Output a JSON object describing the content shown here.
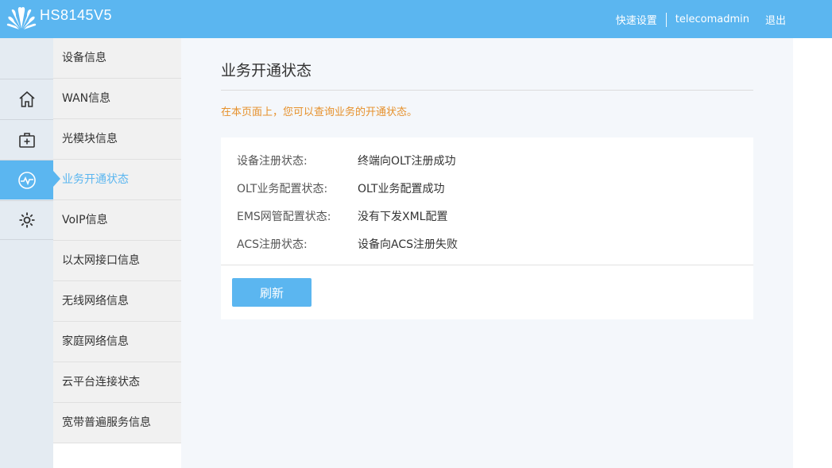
{
  "header": {
    "model": "HS8145V5",
    "quick_setup": "快速设置",
    "username": "telecomadmin",
    "logout": "退出",
    "accent_color": "#5bb6f0"
  },
  "rail": {
    "items": [
      {
        "icon": "home-icon"
      },
      {
        "icon": "medkit-icon"
      },
      {
        "icon": "pulse-icon",
        "active": true
      },
      {
        "icon": "gear-icon"
      }
    ]
  },
  "menu": {
    "items": [
      {
        "label": "设备信息"
      },
      {
        "label": "WAN信息"
      },
      {
        "label": "光模块信息"
      },
      {
        "label": "业务开通状态",
        "active": true
      },
      {
        "label": "VoIP信息"
      },
      {
        "label": "以太网接口信息"
      },
      {
        "label": "无线网络信息"
      },
      {
        "label": "家庭网络信息"
      },
      {
        "label": "云平台连接状态"
      },
      {
        "label": "宽带普遍服务信息"
      }
    ]
  },
  "main": {
    "title": "业务开通状态",
    "hint": "在本页面上，您可以查询业务的开通状态。",
    "hint_color": "#e6912c",
    "rows": [
      {
        "label": "设备注册状态:",
        "value": "终端向OLT注册成功"
      },
      {
        "label": "OLT业务配置状态:",
        "value": "OLT业务配置成功"
      },
      {
        "label": "EMS网管配置状态:",
        "value": "没有下发XML配置"
      },
      {
        "label": "ACS注册状态:",
        "value": "设备向ACS注册失败"
      }
    ],
    "refresh_label": "刷新"
  }
}
